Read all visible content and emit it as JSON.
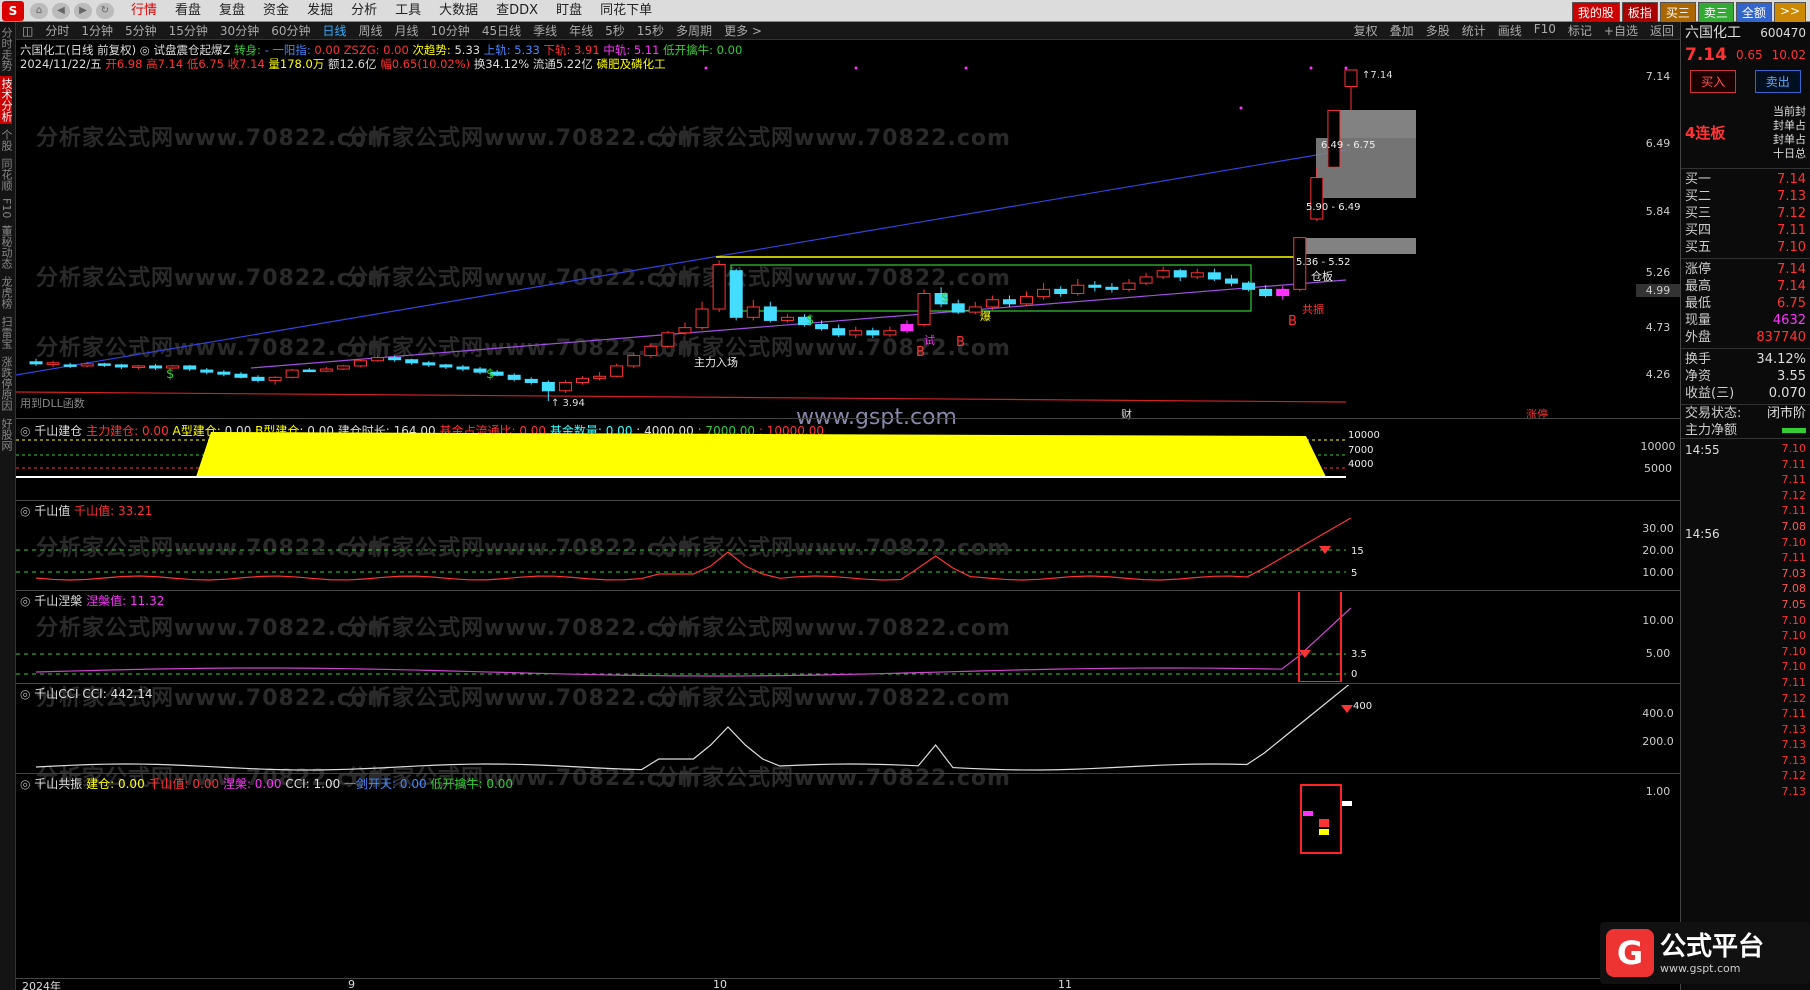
{
  "menu": {
    "logo": "S",
    "items": [
      "行情",
      "看盘",
      "复盘",
      "资金",
      "发掘",
      "分析",
      "工具",
      "大数据",
      "查DDX",
      "盯盘",
      "同花下单"
    ],
    "active_index": 0,
    "right_buttons": [
      {
        "label": "我的股",
        "bg": "#c00"
      },
      {
        "label": "板指",
        "bg": "#a00"
      },
      {
        "label": "买三",
        "bg": "#a60"
      },
      {
        "label": "卖三",
        "bg": "#3a3"
      },
      {
        "label": "全额",
        "bg": "#36c"
      },
      {
        "label": ">>",
        "bg": "#c80"
      }
    ]
  },
  "left_strip": [
    "分时走势",
    "技术分析",
    "个股",
    "同花顺",
    "F10",
    "董秘动态",
    "龙虎榜",
    "扫雷宝",
    "涨跌停原因",
    "好股网"
  ],
  "left_strip_active": 1,
  "periods": [
    "分时",
    "1分钟",
    "5分钟",
    "15分钟",
    "30分钟",
    "60分钟",
    "日线",
    "周线",
    "月线",
    "10分钟",
    "45日线",
    "季线",
    "年线",
    "5秒",
    "15秒",
    "多周期",
    "更多 >"
  ],
  "period_active": 6,
  "period_right": [
    "复权",
    "叠加",
    "多股",
    "统计",
    "画线",
    "F10",
    "标记",
    "+自选",
    "返回"
  ],
  "header": {
    "line1": [
      {
        "t": "六国化工(日线 前复权)",
        "c": "w"
      },
      {
        "t": "◎ 试盘震仓起爆Z",
        "c": "w"
      },
      {
        "t": "转身:",
        "c": "g"
      },
      {
        "t": "- 一阳指:",
        "c": "b"
      },
      {
        "t": "0.00",
        "c": "r"
      },
      {
        "t": "ZSZG:",
        "c": "r"
      },
      {
        "t": "0.00",
        "c": "r"
      },
      {
        "t": "次趋势:",
        "c": "y"
      },
      {
        "t": "5.33",
        "c": "w"
      },
      {
        "t": "上轨: 5.33",
        "c": "b"
      },
      {
        "t": "下轨: 3.91",
        "c": "r"
      },
      {
        "t": "中轨: 5.11",
        "c": "m"
      },
      {
        "t": "低开擒牛:",
        "c": "g"
      },
      {
        "t": "0.00",
        "c": "g"
      }
    ],
    "line2": [
      {
        "t": "2024/11/22/五",
        "c": "w"
      },
      {
        "t": "开6.98",
        "c": "r"
      },
      {
        "t": "高7.14",
        "c": "r"
      },
      {
        "t": "低6.75",
        "c": "r"
      },
      {
        "t": "收7.14",
        "c": "r"
      },
      {
        "t": "量178.0万",
        "c": "y"
      },
      {
        "t": "额12.6亿",
        "c": "w"
      },
      {
        "t": "幅0.65(10.02%)",
        "c": "r"
      },
      {
        "t": "换34.12%",
        "c": "w"
      },
      {
        "t": "流通5.22亿",
        "c": "w"
      },
      {
        "t": "磷肥及磷化工",
        "c": "y"
      }
    ]
  },
  "price_axis": [
    "7.14",
    "6.49",
    "5.84",
    "5.26",
    "4.99",
    "4.73",
    "4.26"
  ],
  "chart_annotations": {
    "low_label": "3.94",
    "high_label": "7.14",
    "zone1": "6.49 - 6.75",
    "zone2": "5.90 - 6.49",
    "zone3": "5.36 - 5.52",
    "main_entry": "主力入场",
    "resonance": "共振",
    "position": "仓板",
    "trial": "试",
    "burst": "爆",
    "cai": "财",
    "zhangting": "涨停",
    "dll_note": "用到DLL函数",
    "watermark": "分析家公式网www.70822.com",
    "site": "www.gspt.com"
  },
  "pane1": {
    "title": "千山建仓",
    "items": [
      {
        "t": "主力建仓:",
        "c": "r"
      },
      {
        "t": "0.00",
        "c": "r"
      },
      {
        "t": "A型建仓:",
        "c": "y"
      },
      {
        "t": "0.00",
        "c": "w"
      },
      {
        "t": "B型建仓:",
        "c": "y"
      },
      {
        "t": "0.00",
        "c": "w"
      },
      {
        "t": "建仓时长:",
        "c": "w"
      },
      {
        "t": "164.00",
        "c": "w"
      },
      {
        "t": "基金占流通比:",
        "c": "r"
      },
      {
        "t": "0.00",
        "c": "r"
      },
      {
        "t": "基金数量:",
        "c": "c"
      },
      {
        "t": "0.00",
        "c": "c"
      },
      {
        "t": ": 4000.00",
        "c": "w"
      },
      {
        "t": ": 7000.00",
        "c": "g"
      },
      {
        "t": ": 10000.00",
        "c": "r"
      }
    ],
    "axis": [
      "10000",
      "5000"
    ],
    "levels": [
      "10000",
      "7000",
      "4000"
    ]
  },
  "pane2": {
    "title": "千山值",
    "items": [
      {
        "t": "千山值:",
        "c": "r"
      },
      {
        "t": "33.21",
        "c": "r"
      }
    ],
    "axis": [
      "30.00",
      "20.00",
      "10.00"
    ],
    "levels": [
      "15",
      "5"
    ]
  },
  "pane3": {
    "title": "千山涅槃",
    "items": [
      {
        "t": "涅槃值:",
        "c": "m"
      },
      {
        "t": "11.32",
        "c": "m"
      }
    ],
    "axis": [
      "10.00",
      "5.00"
    ],
    "levels": [
      "3.5",
      "0"
    ]
  },
  "pane4": {
    "title": "千山CCI",
    "items": [
      {
        "t": "CCI:",
        "c": "w"
      },
      {
        "t": "442.14",
        "c": "w"
      }
    ],
    "axis": [
      "400.0",
      "200.0"
    ],
    "levels": [
      "400"
    ]
  },
  "pane5": {
    "title": "千山共振",
    "items": [
      {
        "t": "建仓:",
        "c": "y"
      },
      {
        "t": "0.00",
        "c": "y"
      },
      {
        "t": "千山值:",
        "c": "r"
      },
      {
        "t": "0.00",
        "c": "r"
      },
      {
        "t": "涅槃:",
        "c": "m"
      },
      {
        "t": "0.00",
        "c": "m"
      },
      {
        "t": "CCI:",
        "c": "w"
      },
      {
        "t": "1.00",
        "c": "w"
      },
      {
        "t": "一剑开天:",
        "c": "b"
      },
      {
        "t": "0.00",
        "c": "b"
      },
      {
        "t": "低开擒牛:",
        "c": "g"
      },
      {
        "t": "0.00",
        "c": "g"
      }
    ],
    "axis": [
      "1.00"
    ]
  },
  "time_axis": [
    "2024年",
    "9",
    "10",
    "11"
  ],
  "right_panel": {
    "name": "六国化工",
    "code": "600470",
    "price": "7.14",
    "change": "0.65",
    "pct": "10.02",
    "buy_btn": "买入",
    "sell_btn": "卖出",
    "board": "4连板",
    "seal_labels": [
      "当前封",
      "封单占",
      "封单占",
      "十日总"
    ],
    "bids": [
      {
        "l": "买一",
        "v": "7.14"
      },
      {
        "l": "买二",
        "v": "7.13"
      },
      {
        "l": "买三",
        "v": "7.12"
      },
      {
        "l": "买四",
        "v": "7.11"
      },
      {
        "l": "买五",
        "v": "7.10"
      }
    ],
    "stats": [
      {
        "l": "涨停",
        "v": "7.14",
        "c": "r"
      },
      {
        "l": "最高",
        "v": "7.14",
        "c": "r"
      },
      {
        "l": "最低",
        "v": "6.75",
        "c": "r"
      },
      {
        "l": "现量",
        "v": "4632",
        "c": "m"
      },
      {
        "l": "外盘",
        "v": "837740",
        "c": "r"
      }
    ],
    "stats2": [
      {
        "l": "换手",
        "v": "34.12%",
        "c": "w"
      },
      {
        "l": "净资",
        "v": "3.55",
        "c": "w"
      },
      {
        "l": "收益(三)",
        "v": "0.070",
        "c": "w"
      }
    ],
    "trade_status_label": "交易状态:",
    "trade_status": "闭市阶",
    "main_net": "主力净额",
    "ticks_time1": "14:55",
    "ticks_time2": "14:56",
    "ticks": [
      "7.10",
      "7.11",
      "7.11",
      "7.12",
      "7.11",
      "7.08",
      "7.10",
      "7.11",
      "7.03",
      "7.08",
      "7.05",
      "7.10",
      "7.10",
      "7.10",
      "7.10",
      "7.11",
      "7.12",
      "7.11",
      "7.13",
      "7.13",
      "7.13",
      "7.12",
      "7.13"
    ]
  },
  "footer_logo": {
    "mark": "G",
    "title": "公式平台",
    "url": "www.gspt.com"
  }
}
